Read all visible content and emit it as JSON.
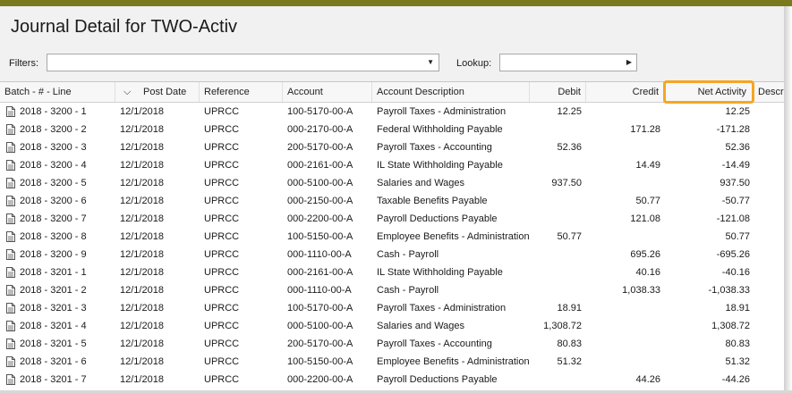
{
  "window": {
    "title": "Journal Detail for TWO-Activ"
  },
  "filters": {
    "label": "Filters:",
    "value": ""
  },
  "lookup": {
    "label": "Lookup:",
    "value": ""
  },
  "columns": {
    "batch": "Batch - # - Line",
    "post_date": "Post Date",
    "reference": "Reference",
    "account": "Account",
    "account_description": "Account Description",
    "debit": "Debit",
    "credit": "Credit",
    "net_activity": "Net Activity",
    "description": "Descrip"
  },
  "accent_colors": {
    "title_bar": "#7a7a1c",
    "highlight": "#f5a623"
  },
  "rows": [
    {
      "batch": "2018 - 3200 - 1",
      "date": "12/1/2018",
      "ref": "UPRCC",
      "account": "100-5170-00-A",
      "desc": "Payroll Taxes - Administration",
      "debit": "12.25",
      "credit": "",
      "net": "12.25"
    },
    {
      "batch": "2018 - 3200 - 2",
      "date": "12/1/2018",
      "ref": "UPRCC",
      "account": "000-2170-00-A",
      "desc": "Federal Withholding Payable",
      "debit": "",
      "credit": "171.28",
      "net": "-171.28"
    },
    {
      "batch": "2018 - 3200 - 3",
      "date": "12/1/2018",
      "ref": "UPRCC",
      "account": "200-5170-00-A",
      "desc": "Payroll Taxes - Accounting",
      "debit": "52.36",
      "credit": "",
      "net": "52.36"
    },
    {
      "batch": "2018 - 3200 - 4",
      "date": "12/1/2018",
      "ref": "UPRCC",
      "account": "000-2161-00-A",
      "desc": "IL State Withholding Payable",
      "debit": "",
      "credit": "14.49",
      "net": "-14.49"
    },
    {
      "batch": "2018 - 3200 - 5",
      "date": "12/1/2018",
      "ref": "UPRCC",
      "account": "000-5100-00-A",
      "desc": "Salaries and Wages",
      "debit": "937.50",
      "credit": "",
      "net": "937.50"
    },
    {
      "batch": "2018 - 3200 - 6",
      "date": "12/1/2018",
      "ref": "UPRCC",
      "account": "000-2150-00-A",
      "desc": "Taxable Benefits Payable",
      "debit": "",
      "credit": "50.77",
      "net": "-50.77"
    },
    {
      "batch": "2018 - 3200 - 7",
      "date": "12/1/2018",
      "ref": "UPRCC",
      "account": "000-2200-00-A",
      "desc": "Payroll Deductions Payable",
      "debit": "",
      "credit": "121.08",
      "net": "-121.08"
    },
    {
      "batch": "2018 - 3200 - 8",
      "date": "12/1/2018",
      "ref": "UPRCC",
      "account": "100-5150-00-A",
      "desc": "Employee Benefits - Administration",
      "debit": "50.77",
      "credit": "",
      "net": "50.77"
    },
    {
      "batch": "2018 - 3200 - 9",
      "date": "12/1/2018",
      "ref": "UPRCC",
      "account": "000-1110-00-A",
      "desc": "Cash - Payroll",
      "debit": "",
      "credit": "695.26",
      "net": "-695.26"
    },
    {
      "batch": "2018 - 3201 - 1",
      "date": "12/1/2018",
      "ref": "UPRCC",
      "account": "000-2161-00-A",
      "desc": "IL State Withholding Payable",
      "debit": "",
      "credit": "40.16",
      "net": "-40.16"
    },
    {
      "batch": "2018 - 3201 - 2",
      "date": "12/1/2018",
      "ref": "UPRCC",
      "account": "000-1110-00-A",
      "desc": "Cash - Payroll",
      "debit": "",
      "credit": "1,038.33",
      "net": "-1,038.33"
    },
    {
      "batch": "2018 - 3201 - 3",
      "date": "12/1/2018",
      "ref": "UPRCC",
      "account": "100-5170-00-A",
      "desc": "Payroll Taxes - Administration",
      "debit": "18.91",
      "credit": "",
      "net": "18.91"
    },
    {
      "batch": "2018 - 3201 - 4",
      "date": "12/1/2018",
      "ref": "UPRCC",
      "account": "000-5100-00-A",
      "desc": "Salaries and Wages",
      "debit": "1,308.72",
      "credit": "",
      "net": "1,308.72"
    },
    {
      "batch": "2018 - 3201 - 5",
      "date": "12/1/2018",
      "ref": "UPRCC",
      "account": "200-5170-00-A",
      "desc": "Payroll Taxes - Accounting",
      "debit": "80.83",
      "credit": "",
      "net": "80.83"
    },
    {
      "batch": "2018 - 3201 - 6",
      "date": "12/1/2018",
      "ref": "UPRCC",
      "account": "100-5150-00-A",
      "desc": "Employee Benefits - Administration",
      "debit": "51.32",
      "credit": "",
      "net": "51.32"
    },
    {
      "batch": "2018 - 3201 - 7",
      "date": "12/1/2018",
      "ref": "UPRCC",
      "account": "000-2200-00-A",
      "desc": "Payroll Deductions Payable",
      "debit": "",
      "credit": "44.26",
      "net": "-44.26"
    }
  ]
}
